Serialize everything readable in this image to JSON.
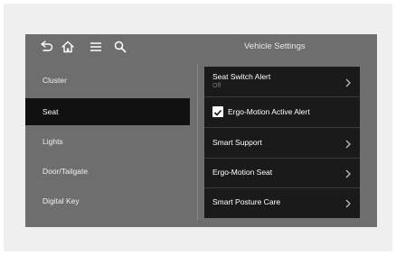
{
  "header": {
    "title": "Vehicle Settings",
    "icons": [
      "back-icon",
      "home-icon",
      "menu-icon",
      "search-icon"
    ]
  },
  "sidebar": {
    "items": [
      {
        "label": "Cluster",
        "active": false
      },
      {
        "label": "Seat",
        "active": true
      },
      {
        "label": "Lights",
        "active": false
      },
      {
        "label": "Door/Tailgate",
        "active": false
      },
      {
        "label": "Digital Key",
        "active": false
      }
    ]
  },
  "panel": {
    "rows": [
      {
        "label": "Seat Switch Alert",
        "sub": "Off",
        "control": "chevron"
      },
      {
        "label": "Ergo-Motion Active Alert",
        "control": "checkbox",
        "checked": true
      },
      {
        "label": "Smart Support",
        "control": "chevron"
      },
      {
        "label": "Ergo-Motion Seat",
        "control": "chevron"
      },
      {
        "label": "Smart Posture Care",
        "control": "chevron"
      }
    ]
  },
  "colors": {
    "screen_bg": "#6e6e6e",
    "panel_bg": "#1a1a1a",
    "active_bg": "#111111"
  }
}
